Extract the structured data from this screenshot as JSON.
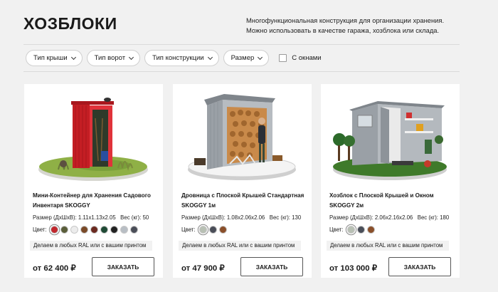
{
  "page": {
    "title": "ХОЗБЛОКИ",
    "description": "Многофункциональная конструкция для организации хранения. Можно использовать в качестве гаража, хозблока или склада."
  },
  "filters": {
    "items": [
      {
        "label": "Тип крыши"
      },
      {
        "label": "Тип ворот"
      },
      {
        "label": "Тип конструкции"
      },
      {
        "label": "Размер"
      }
    ],
    "windows_label": "С окнами"
  },
  "products": [
    {
      "name": "Мини-Контейнер для Хранения Садового Инвентаря SKOGGY",
      "size_label": "Размер (ДхШхВ):",
      "size_value": "1.11x1.13x2.05",
      "weight_label": "Вес (кг):",
      "weight_value": "50",
      "color_label": "Цвет:",
      "swatches": [
        "#c1272d",
        "#5a5e3a",
        "#ececec",
        "#7a4a28",
        "#6b2a20",
        "#1f4a35",
        "#222222",
        "#b8bec4",
        "#4a4e58"
      ],
      "ral_note": "Делаем в любых RAL или с вашим принтом",
      "price": "от 62 400 ₽",
      "order_label": "ЗАКАЗАТЬ"
    },
    {
      "name": "Дровница с Плоской Крышей Стандартная SKOGGY 1м",
      "size_label": "Размер (ДхШхВ):",
      "size_value": "1.08x2.06x2.06",
      "weight_label": "Вес (кг):",
      "weight_value": "130",
      "color_label": "Цвет:",
      "swatches": [
        "#b8c0b4",
        "#4a4e58",
        "#8a4f2a"
      ],
      "ral_note": "Делаем в любых RAL или с вашим принтом",
      "price": "от 47 900 ₽",
      "order_label": "ЗАКАЗАТЬ"
    },
    {
      "name": "Хозблок с Плоской Крышей и Окном SKOGGY 2м",
      "size_label": "Размер (ДхШхВ):",
      "size_value": "2.06x2.16x2.06",
      "weight_label": "Вес (кг):",
      "weight_value": "180",
      "color_label": "Цвет:",
      "swatches": [
        "#b8c0b4",
        "#4a4e58",
        "#8a4f2a"
      ],
      "ral_note": "Делаем в любых RAL или с вашим принтом",
      "price": "от 103 000 ₽",
      "order_label": "ЗАКАЗАТЬ"
    }
  ]
}
